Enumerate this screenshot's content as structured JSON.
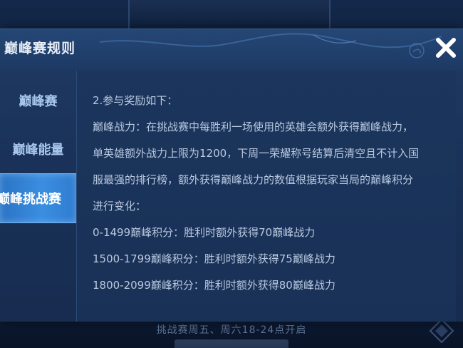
{
  "background": {
    "bottom_text": "挑战赛周五、周六18-24点开启"
  },
  "modal": {
    "title": "巅峰赛规则"
  },
  "sidebar": {
    "items": [
      {
        "label": "巅峰赛"
      },
      {
        "label": "巅峰能量"
      },
      {
        "label": "巅峰挑战赛",
        "selected": true
      }
    ]
  },
  "content": {
    "lines": [
      "2.参与奖励如下：",
      "巅峰战力：在挑战赛中每胜利一场使用的英雄会额外获得巅峰战力，",
      "单英雄额外战力上限为1200，下周一荣耀称号结算后清空且不计入国",
      "服最强的排行榜，额外获得巅峰战力的数值根据玩家当局的巅峰积分",
      "进行变化：",
      "0-1499巅峰积分：胜利时额外获得70巅峰战力",
      "1500-1799巅峰积分：胜利时额外获得75巅峰战力",
      "1800-2099巅峰积分：胜利时额外获得80巅峰战力"
    ]
  },
  "colors": {
    "accent": "#3b8ee0",
    "panel": "#1a3259",
    "text": "#b9c9e0"
  },
  "icons": {
    "close": "close-icon"
  }
}
